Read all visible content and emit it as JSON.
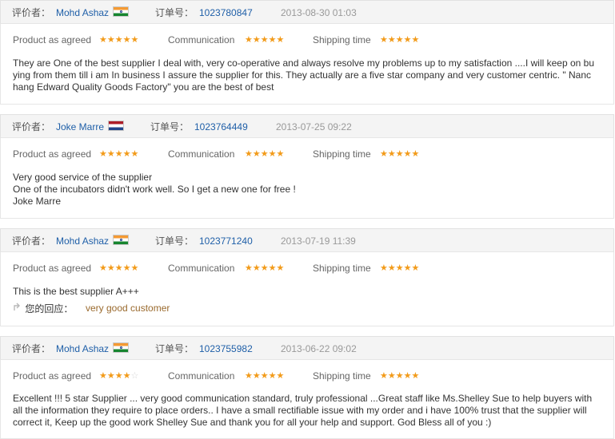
{
  "labels": {
    "reviewer": "评价者：",
    "order": "订单号：",
    "product": "Product as agreed",
    "communication": "Communication",
    "shipping": "Shipping time",
    "reply": "您的回应："
  },
  "colors": {
    "star": "#f29b1a",
    "link": "#1f5fa8",
    "reply_text": "#9a6a2e"
  },
  "reviews": [
    {
      "user": "Mohd Ashaz",
      "flag": "india-flag-icon",
      "order_no": "1023780847",
      "date": "2013-08-30 01:03",
      "ratings": {
        "product": 5,
        "communication": 5,
        "shipping": 5
      },
      "product_stars": "★★★★★",
      "communication_stars": "★★★★★",
      "shipping_stars": "★★★★★",
      "text": "They are One of the best supplier I deal with, very co-operative and always resolve my problems up to my satisfaction ....I will keep on bu\nying from them till i am In business I assure the supplier for this. They actually are a five star company and very customer centric. \" Nanc\nhang Edward Quality Goods Factory\" you are the best of best"
    },
    {
      "user": "Joke Marre",
      "flag": "netherlands-flag-icon",
      "order_no": "1023764449",
      "date": "2013-07-25 09:22",
      "ratings": {
        "product": 5,
        "communication": 5,
        "shipping": 5
      },
      "product_stars": "★★★★★",
      "communication_stars": "★★★★★",
      "shipping_stars": "★★★★★",
      "text": "Very good service of the supplier\nOne of the incubators didn't work well. So I get a new one for free !\nJoke Marre"
    },
    {
      "user": "Mohd Ashaz",
      "flag": "india-flag-icon",
      "order_no": "1023771240",
      "date": "2013-07-19 11:39",
      "ratings": {
        "product": 5,
        "communication": 5,
        "shipping": 5
      },
      "product_stars": "★★★★★",
      "communication_stars": "★★★★★",
      "shipping_stars": "★★★★★",
      "text": "This is the best supplier A+++",
      "reply": "very good customer"
    },
    {
      "user": "Mohd Ashaz",
      "flag": "india-flag-icon",
      "order_no": "1023755982",
      "date": "2013-06-22 09:02",
      "ratings": {
        "product": 4,
        "communication": 5,
        "shipping": 5
      },
      "product_stars": "★★★★",
      "product_stars_empty": "☆",
      "communication_stars": "★★★★★",
      "shipping_stars": "★★★★★",
      "text": "Excellent !!! 5 star Supplier ... very good communication standard, truly professional ...Great staff like Ms.Shelley Sue to help buyers with\nall the information they require to place orders.. I have a small rectifiable issue with my order and i have 100% trust that the supplier will\ncorrect it, Keep up the good work Shelley Sue and thank you for all your help and support. God Bless all of you :)"
    }
  ]
}
